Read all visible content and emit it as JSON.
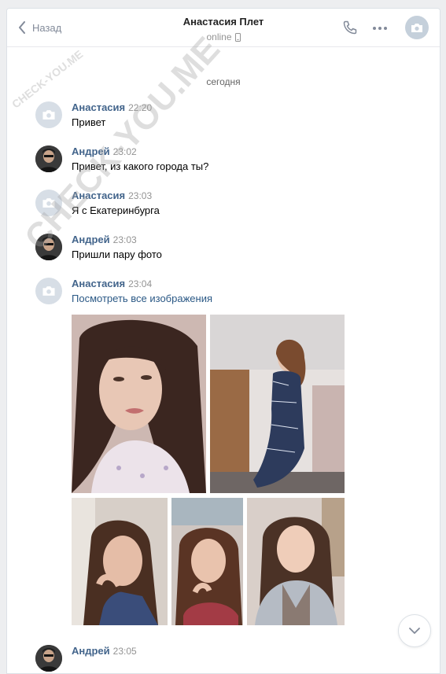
{
  "header": {
    "back_label": "Назад",
    "contact_name": "Анастасия Плет",
    "status": "online"
  },
  "watermark": {
    "text_small": "CHECK-YOU.ME",
    "text_large": "CHECK-YOU.ME"
  },
  "date_separator": "сегодня",
  "messages": [
    {
      "author": "Анастасия",
      "time": "22:20",
      "text": "Привет"
    },
    {
      "author": "Андрей",
      "time": "23:02",
      "text": "Привет, из какого города ты?"
    },
    {
      "author": "Анастасия",
      "time": "23:03",
      "text": "Я с Екатеринбурга"
    },
    {
      "author": "Андрей",
      "time": "23:03",
      "text": "Пришли пару фото"
    },
    {
      "author": "Анастасия",
      "time": "23:04",
      "text": "Посмотреть все изображения"
    },
    {
      "author": "Андрей",
      "time": "23:05",
      "text": ""
    }
  ],
  "icons": {
    "back": "chevron-left-icon",
    "call": "phone-icon",
    "more": "more-dots-icon",
    "camera": "camera-icon",
    "mobile": "mobile-phone-icon",
    "scroll_down": "chevron-down-icon"
  },
  "colors": {
    "author": "#42648b",
    "link": "#2a5885",
    "muted": "#939393",
    "avatar_placeholder": "#d7dee6"
  }
}
